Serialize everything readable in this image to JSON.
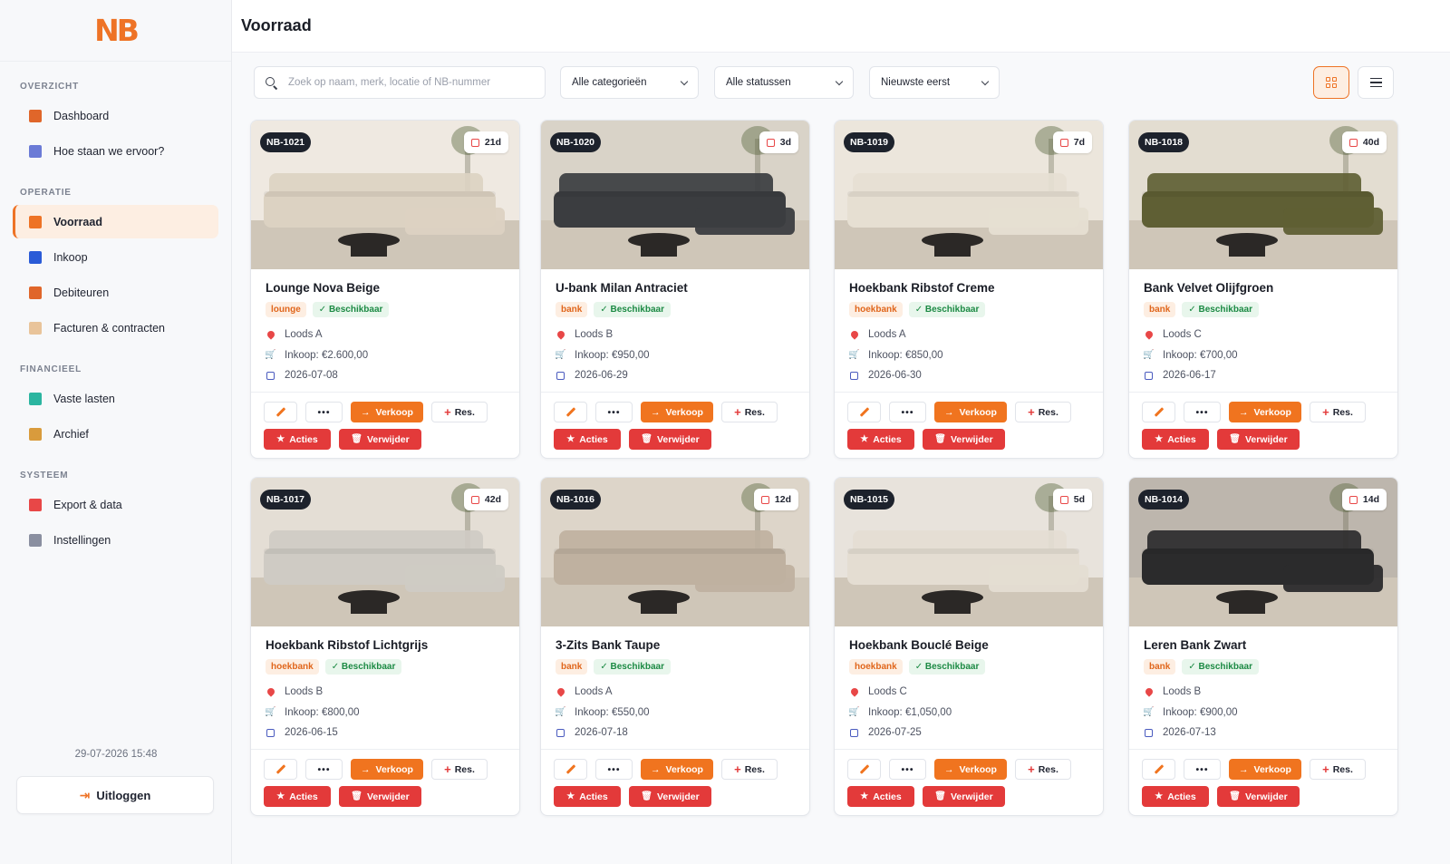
{
  "app": {
    "logo_text": "NB"
  },
  "header": {
    "title": "Voorraad"
  },
  "sidebar": {
    "sections": [
      {
        "label": "OVERZICHT",
        "items": [
          {
            "label": "Dashboard",
            "icon": "chart-icon",
            "color": "#e0662a"
          },
          {
            "label": "Hoe staan we ervoor?",
            "icon": "trend-icon",
            "color": "#6b7bd6"
          }
        ]
      },
      {
        "label": "OPERATIE",
        "items": [
          {
            "label": "Voorraad",
            "icon": "box-icon",
            "color": "#ee7326",
            "active": true
          },
          {
            "label": "Inkoop",
            "icon": "cart-icon",
            "color": "#2a5bd7"
          },
          {
            "label": "Debiteuren",
            "icon": "users-icon",
            "color": "#e0662a"
          },
          {
            "label": "Facturen & contracten",
            "icon": "document-icon",
            "color": "#e9c49a"
          }
        ]
      },
      {
        "label": "FINANCIEEL",
        "items": [
          {
            "label": "Vaste lasten",
            "icon": "tag-icon",
            "color": "#2bb5a0"
          },
          {
            "label": "Archief",
            "icon": "archive-icon",
            "color": "#d99b3c"
          }
        ]
      },
      {
        "label": "SYSTEEM",
        "items": [
          {
            "label": "Export & data",
            "icon": "export-icon",
            "color": "#e84747"
          },
          {
            "label": "Instellingen",
            "icon": "gear-icon",
            "color": "#8a8fa0"
          }
        ]
      }
    ],
    "timestamp": "29-07-2026 15:48",
    "logout_label": "Uitloggen"
  },
  "toolbar": {
    "search_placeholder": "Zoek op naam, merk, locatie of NB-nummer",
    "category_filter": "Alle categorieën",
    "status_filter": "Alle statussen",
    "sort": "Nieuwste eerst"
  },
  "labels": {
    "purchase_prefix": "Inkoop:",
    "more": "•••",
    "sell": "Verkoop",
    "reserve": "Res.",
    "actions": "Acties",
    "delete": "Verwijder"
  },
  "products": [
    {
      "id": "NB-1021",
      "days": "21d",
      "name": "Lounge Nova Beige",
      "category": "lounge",
      "status": "Beschikbaar",
      "location": "Loods A",
      "purchase": "€2.600,00",
      "date": "2026-07-08",
      "sofa_color": "#dcd2c2",
      "bg_color": "#efe9e1"
    },
    {
      "id": "NB-1020",
      "days": "3d",
      "name": "U-bank Milan Antraciet",
      "category": "bank",
      "status": "Beschikbaar",
      "location": "Loods B",
      "purchase": "€950,00",
      "date": "2026-06-29",
      "sofa_color": "#3b3d40",
      "bg_color": "#d9d3c8"
    },
    {
      "id": "NB-1019",
      "days": "7d",
      "name": "Hoekbank Ribstof Creme",
      "category": "hoekbank",
      "status": "Beschikbaar",
      "location": "Loods A",
      "purchase": "€850,00",
      "date": "2026-06-30",
      "sofa_color": "#e6dfd2",
      "bg_color": "#ece6dc"
    },
    {
      "id": "NB-1018",
      "days": "40d",
      "name": "Bank Velvet Olijfgroen",
      "category": "bank",
      "status": "Beschikbaar",
      "location": "Loods C",
      "purchase": "€700,00",
      "date": "2026-06-17",
      "sofa_color": "#5f5f34",
      "bg_color": "#e3ddd1"
    },
    {
      "id": "NB-1017",
      "days": "42d",
      "name": "Hoekbank Ribstof Lichtgrijs",
      "category": "hoekbank",
      "status": "Beschikbaar",
      "location": "Loods B",
      "purchase": "€800,00",
      "date": "2026-06-15",
      "sofa_color": "#cfcbc4",
      "bg_color": "#e4ded5"
    },
    {
      "id": "NB-1016",
      "days": "12d",
      "name": "3-Zits Bank Taupe",
      "category": "bank",
      "status": "Beschikbaar",
      "location": "Loods A",
      "purchase": "€550,00",
      "date": "2026-07-18",
      "sofa_color": "#bfb1a0",
      "bg_color": "#ddd5c9"
    },
    {
      "id": "NB-1015",
      "days": "5d",
      "name": "Hoekbank Bouclé Beige",
      "category": "hoekbank",
      "status": "Beschikbaar",
      "location": "Loods C",
      "purchase": "€1,050,00",
      "date": "2026-07-25",
      "sofa_color": "#e4ddd2",
      "bg_color": "#e8e3dc"
    },
    {
      "id": "NB-1014",
      "days": "14d",
      "name": "Leren Bank Zwart",
      "category": "bank",
      "status": "Beschikbaar",
      "location": "Loods B",
      "purchase": "€900,00",
      "date": "2026-07-13",
      "sofa_color": "#2b2b2c",
      "bg_color": "#bdb6ad"
    }
  ]
}
